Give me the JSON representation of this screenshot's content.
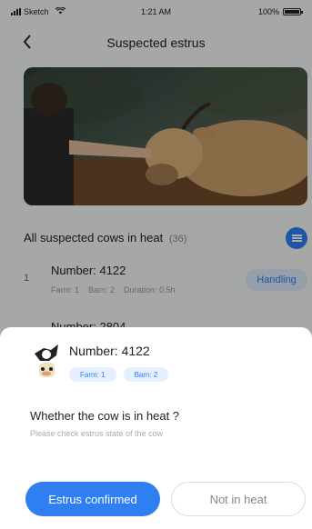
{
  "status_bar": {
    "carrier": "Sketch",
    "time": "1:21 AM",
    "battery": "100%",
    "battery_level": 1.0,
    "icons": [
      "signal-icon",
      "wifi-icon",
      "battery-icon"
    ]
  },
  "nav": {
    "title": "Suspected estrus",
    "back_icon": "chevron-left-icon"
  },
  "section": {
    "title": "All suspected cows in heat",
    "count": "(36)",
    "filter_icon": "filter-list-icon"
  },
  "list": [
    {
      "index": "1",
      "number": "Number: 4122",
      "farm": "Farm: 1",
      "barn": "Barn: 2",
      "duration": "Duration: 0.5h",
      "status": "Handling"
    },
    {
      "number": "Number: 2804"
    }
  ],
  "sheet": {
    "number": "Number: 4122",
    "farm": "Farm: 1",
    "barn": "Barn: 2",
    "question": "Whether the cow is in heat ?",
    "hint": "Please check estrus state of the cow",
    "confirm_label": "Estrus confirmed",
    "reject_label": "Not in heat"
  },
  "colors": {
    "accent": "#2f7ff0",
    "tag_bg": "#e4efff",
    "mask": "rgba(0,0,0,0.32)"
  }
}
